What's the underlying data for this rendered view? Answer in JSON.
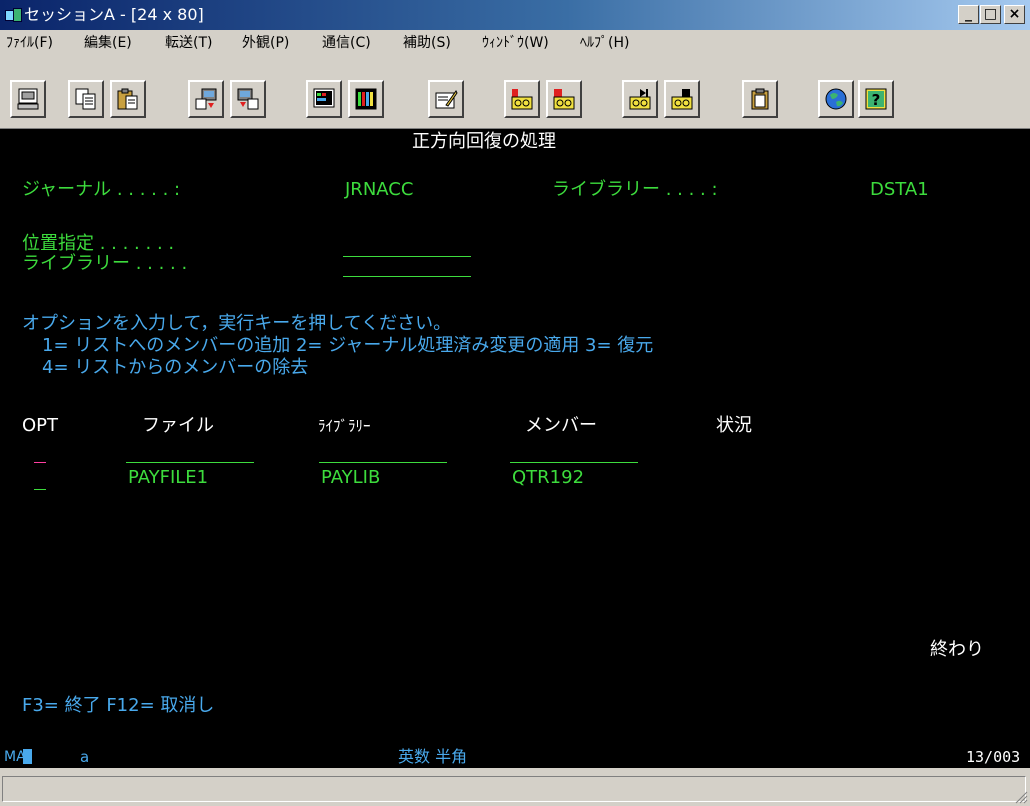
{
  "window": {
    "title": "セッションA - [24 x 80]",
    "controls": {
      "minimize": "_",
      "maximize": "□",
      "close": "×"
    }
  },
  "menubar": {
    "items": [
      "ﾌｧｲﾙ(F)",
      "編集(E)",
      "転送(T)",
      "外観(P)",
      "通信(C)",
      "補助(S)",
      "ｳｨﾝﾄﾞｳ(W)",
      "ﾍﾙﾌﾟ(H)"
    ]
  },
  "toolbar": {
    "buttons": [
      "print-screen-icon",
      "copy-icon",
      "paste-icon",
      "send-file-icon",
      "receive-file-icon",
      "display-icon",
      "color-map-icon",
      "edit-icon",
      "record-macro-icon",
      "stop-macro-icon",
      "play-macro-icon",
      "stop-play-icon",
      "clipboard-icon",
      "web-icon",
      "help-icon"
    ]
  },
  "screen": {
    "title": "正方向回復の処理",
    "journal_label": "ジャーナル . . . . . :",
    "journal_value": "JRNACC",
    "journal_lib_label": "ライブラリー . . . . :",
    "journal_lib_value": "DSTA1",
    "position_label": "位置指定 . . . . . . .",
    "position_lib_label": "ライブラリー . . . . .",
    "instruction": "オプションを入力して，実行キーを押してください。",
    "options_line1": "1= リストへのメンバーの追加   2= ジャーナル処理済み変更の適用   3= 復元",
    "options_line2": "4= リストからのメンバーの除去",
    "col_opt": "OPT",
    "col_file": "ファイル",
    "col_library": "ﾗｲﾌﾞﾗﾘｰ",
    "col_member": "メンバー",
    "col_status": "状況",
    "rows": [
      {
        "opt": "",
        "file": "",
        "library": "",
        "member": ""
      },
      {
        "opt": "",
        "file": "PAYFILE1",
        "library": "PAYLIB",
        "member": "QTR192"
      }
    ],
    "end_marker": "終わり",
    "fkeys": "F3= 終了   F12= 取消し"
  },
  "status": {
    "indicator": "MA",
    "cursor_mark": "a",
    "mode": "英数 半角",
    "position": "13/003"
  },
  "colors": {
    "field": "#3ddc3d",
    "heading": "#ffffff",
    "info": "#49a9ec",
    "input_underscore": "#ff3fa0"
  }
}
